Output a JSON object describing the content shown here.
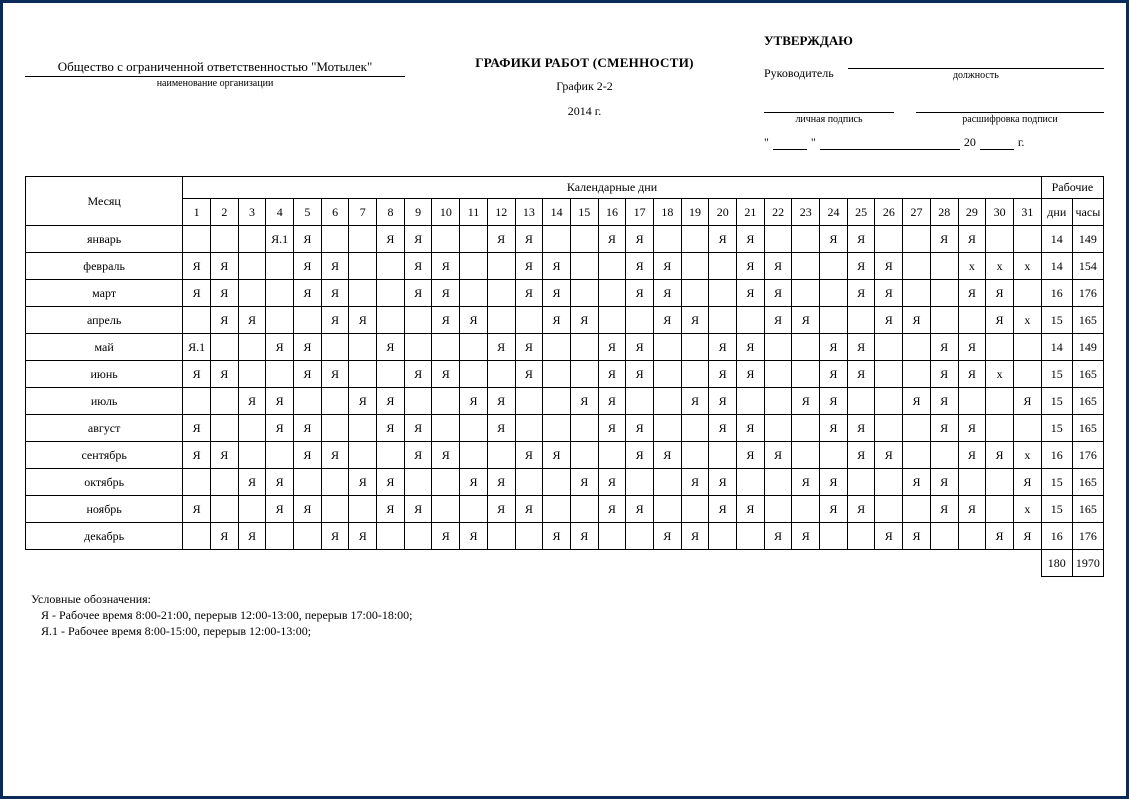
{
  "header": {
    "org_name": "Общество с ограниченной ответственностью \"Мотылек\"",
    "org_caption": "наименование организации",
    "title_main": "ГРАФИКИ РАБОТ (СМЕННОСТИ)",
    "title_sub": "График 2-2",
    "title_year": "2014 г.",
    "approve": {
      "title": "УТВЕРЖДАЮ",
      "role_label": "Руководитель",
      "role_caption": "должность",
      "sig_caption": "личная подпись",
      "decode_caption": "расшифровка подписи",
      "date_q1": "\"",
      "date_q2": "\"",
      "date_20": "20",
      "date_yr_suffix": "г."
    }
  },
  "table": {
    "col_month": "Месяц",
    "col_days": "Календарные дни",
    "col_work": "Рабочие",
    "col_dni": "дни",
    "col_hours": "часы",
    "day_nums": [
      "1",
      "2",
      "3",
      "4",
      "5",
      "6",
      "7",
      "8",
      "9",
      "10",
      "11",
      "12",
      "13",
      "14",
      "15",
      "16",
      "17",
      "18",
      "19",
      "20",
      "21",
      "22",
      "23",
      "24",
      "25",
      "26",
      "27",
      "28",
      "29",
      "30",
      "31"
    ],
    "rows": [
      {
        "m": "январь",
        "d": [
          "",
          "",
          "",
          "Я.1",
          "Я",
          "",
          "",
          "Я",
          "Я",
          "",
          "",
          "Я",
          "Я",
          "",
          "",
          "Я",
          "Я",
          "",
          "",
          "Я",
          "Я",
          "",
          "",
          "Я",
          "Я",
          "",
          "",
          "Я",
          "Я",
          "",
          ""
        ],
        "dni": "14",
        "h": "149"
      },
      {
        "m": "февраль",
        "d": [
          "Я",
          "Я",
          "",
          "",
          "Я",
          "Я",
          "",
          "",
          "Я",
          "Я",
          "",
          "",
          "Я",
          "Я",
          "",
          "",
          "Я",
          "Я",
          "",
          "",
          "Я",
          "Я",
          "",
          "",
          "Я",
          "Я",
          "",
          "",
          "х",
          "х",
          "х"
        ],
        "dni": "14",
        "h": "154"
      },
      {
        "m": "март",
        "d": [
          "Я",
          "Я",
          "",
          "",
          "Я",
          "Я",
          "",
          "",
          "Я",
          "Я",
          "",
          "",
          "Я",
          "Я",
          "",
          "",
          "Я",
          "Я",
          "",
          "",
          "Я",
          "Я",
          "",
          "",
          "Я",
          "Я",
          "",
          "",
          "Я",
          "Я",
          ""
        ],
        "dni": "16",
        "h": "176"
      },
      {
        "m": "апрель",
        "d": [
          "",
          "Я",
          "Я",
          "",
          "",
          "Я",
          "Я",
          "",
          "",
          "Я",
          "Я",
          "",
          "",
          "Я",
          "Я",
          "",
          "",
          "Я",
          "Я",
          "",
          "",
          "Я",
          "Я",
          "",
          "",
          "Я",
          "Я",
          "",
          "",
          "Я",
          "х"
        ],
        "dni": "15",
        "h": "165"
      },
      {
        "m": "май",
        "d": [
          "Я.1",
          "",
          "",
          "Я",
          "Я",
          "",
          "",
          "Я",
          "",
          "",
          "",
          "Я",
          "Я",
          "",
          "",
          "Я",
          "Я",
          "",
          "",
          "Я",
          "Я",
          "",
          "",
          "Я",
          "Я",
          "",
          "",
          "Я",
          "Я",
          "",
          ""
        ],
        "dni": "14",
        "h": "149"
      },
      {
        "m": "июнь",
        "d": [
          "Я",
          "Я",
          "",
          "",
          "Я",
          "Я",
          "",
          "",
          "Я",
          "Я",
          "",
          "",
          "Я",
          "",
          "",
          "Я",
          "Я",
          "",
          "",
          "Я",
          "Я",
          "",
          "",
          "Я",
          "Я",
          "",
          "",
          "Я",
          "Я",
          "х"
        ],
        "dni": "15",
        "h": "165"
      },
      {
        "m": "июль",
        "d": [
          "",
          "",
          "Я",
          "Я",
          "",
          "",
          "Я",
          "Я",
          "",
          "",
          "Я",
          "Я",
          "",
          "",
          "Я",
          "Я",
          "",
          "",
          "Я",
          "Я",
          "",
          "",
          "Я",
          "Я",
          "",
          "",
          "Я",
          "Я",
          "",
          "",
          "Я"
        ],
        "dni": "15",
        "h": "165"
      },
      {
        "m": "август",
        "d": [
          "Я",
          "",
          "",
          "Я",
          "Я",
          "",
          "",
          "Я",
          "Я",
          "",
          "",
          "Я",
          "",
          "",
          "",
          "Я",
          "Я",
          "",
          "",
          "Я",
          "Я",
          "",
          "",
          "Я",
          "Я",
          "",
          "",
          "Я",
          "Я",
          "",
          ""
        ],
        "dni": "15",
        "h": "165"
      },
      {
        "m": "сентябрь",
        "d": [
          "Я",
          "Я",
          "",
          "",
          "Я",
          "Я",
          "",
          "",
          "Я",
          "Я",
          "",
          "",
          "Я",
          "Я",
          "",
          "",
          "Я",
          "Я",
          "",
          "",
          "Я",
          "Я",
          "",
          "",
          "Я",
          "Я",
          "",
          "",
          "Я",
          "Я",
          "х"
        ],
        "dni": "16",
        "h": "176"
      },
      {
        "m": "октябрь",
        "d": [
          "",
          "",
          "Я",
          "Я",
          "",
          "",
          "Я",
          "Я",
          "",
          "",
          "Я",
          "Я",
          "",
          "",
          "Я",
          "Я",
          "",
          "",
          "Я",
          "Я",
          "",
          "",
          "Я",
          "Я",
          "",
          "",
          "Я",
          "Я",
          "",
          "",
          "Я"
        ],
        "dni": "15",
        "h": "165"
      },
      {
        "m": "ноябрь",
        "d": [
          "Я",
          "",
          "",
          "Я",
          "Я",
          "",
          "",
          "Я",
          "Я",
          "",
          "",
          "Я",
          "Я",
          "",
          "",
          "Я",
          "Я",
          "",
          "",
          "Я",
          "Я",
          "",
          "",
          "Я",
          "Я",
          "",
          "",
          "Я",
          "Я",
          "",
          "х"
        ],
        "dni": "15",
        "h": "165"
      },
      {
        "m": "декабрь",
        "d": [
          "",
          "Я",
          "Я",
          "",
          "",
          "Я",
          "Я",
          "",
          "",
          "Я",
          "Я",
          "",
          "",
          "Я",
          "Я",
          "",
          "",
          "Я",
          "Я",
          "",
          "",
          "Я",
          "Я",
          "",
          "",
          "Я",
          "Я",
          "",
          "",
          "Я",
          "Я"
        ],
        "dni": "16",
        "h": "176"
      }
    ],
    "total_dni": "180",
    "total_hours": "1970"
  },
  "legend": {
    "title": "Условные обозначения:",
    "items": [
      "Я -  Рабочее время 8:00-21:00, перерыв 12:00-13:00, перерыв 17:00-18:00;",
      "Я.1 -  Рабочее время 8:00-15:00, перерыв 12:00-13:00;"
    ]
  }
}
